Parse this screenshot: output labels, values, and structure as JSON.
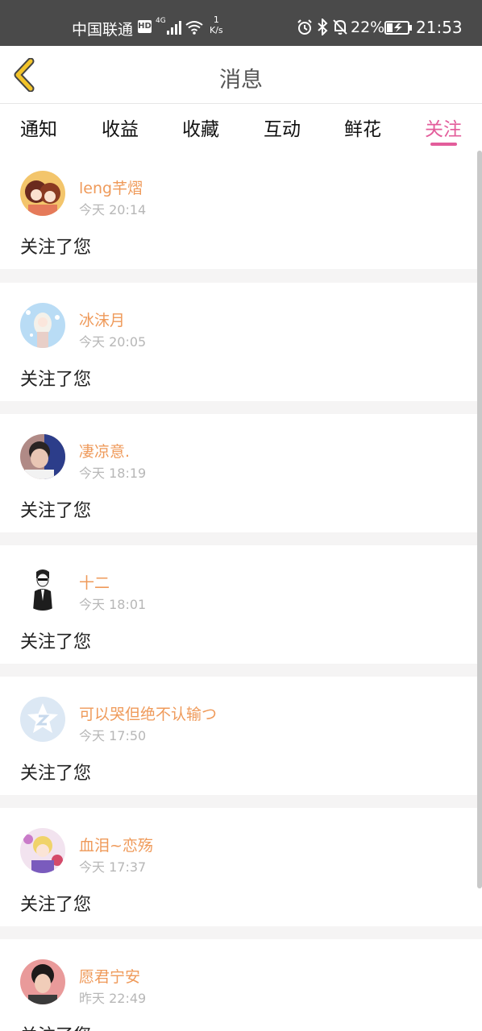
{
  "status_bar": {
    "carrier": "中国联通",
    "hd": "HD",
    "network": "4G",
    "speed_value": "1",
    "speed_unit": "K/s",
    "battery": "22%",
    "time": "21:53"
  },
  "header": {
    "title": "消息"
  },
  "tabs": [
    {
      "label": "通知",
      "active": false
    },
    {
      "label": "收益",
      "active": false
    },
    {
      "label": "收藏",
      "active": false
    },
    {
      "label": "互动",
      "active": false
    },
    {
      "label": "鲜花",
      "active": false
    },
    {
      "label": "关注",
      "active": true
    }
  ],
  "colors": {
    "accent": "#e35d9b",
    "username": "#ef9a5a",
    "status_bar": "#4a4a4a"
  },
  "messages": [
    {
      "name": "leng芊熠",
      "time": "今天 20:14",
      "text": "关注了您"
    },
    {
      "name": "冰沫月",
      "time": "今天 20:05",
      "text": "关注了您"
    },
    {
      "name": "凄凉意.",
      "time": "今天 18:19",
      "text": "关注了您"
    },
    {
      "name": "十二",
      "time": "今天 18:01",
      "text": "关注了您"
    },
    {
      "name": "可以哭但绝不认输つ",
      "time": "今天 17:50",
      "text": "关注了您"
    },
    {
      "name": "血泪~恋殇",
      "time": "今天 17:37",
      "text": "关注了您"
    },
    {
      "name": "愿君宁安",
      "time": "昨天 22:49",
      "text": "关注了您"
    }
  ]
}
